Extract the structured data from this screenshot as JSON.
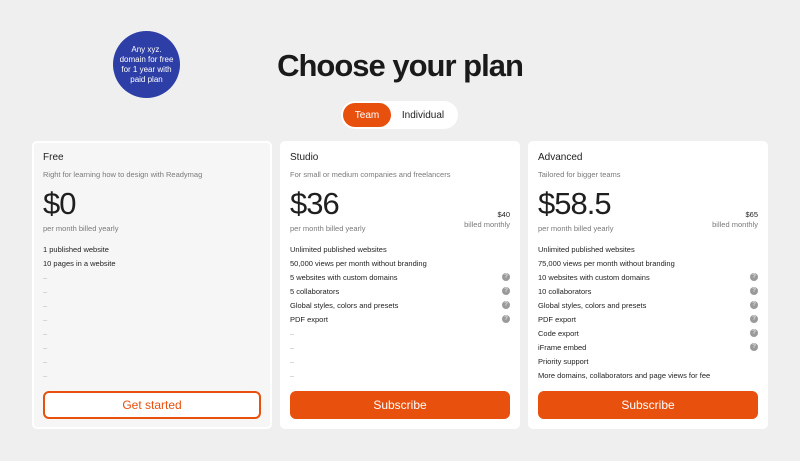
{
  "badge": {
    "text": "Any xyz. domain for free for 1 year with paid plan"
  },
  "page_title": "Choose your plan",
  "toggle": {
    "team": "Team",
    "individual": "Individual"
  },
  "colors": {
    "accent": "#e8500e",
    "badge": "#2d3ea6",
    "background": "#efefef"
  },
  "plans": [
    {
      "name": "Free",
      "description": "Right for learning how to design with Readymag",
      "price": "$0",
      "price_note": "per month billed yearly",
      "features": [
        "1 published website",
        "10 pages in a website",
        "–",
        "–",
        "–",
        "–",
        "–",
        "–",
        "–",
        "–"
      ],
      "help_rows": [],
      "cta": "Get started"
    },
    {
      "name": "Studio",
      "description": "For small or medium companies and freelancers",
      "price": "$36",
      "price_note": "per month billed yearly",
      "alt_price": "$40",
      "alt_note": "billed monthly",
      "features": [
        "Unlimited published websites",
        "50,000 views per month without branding",
        "5 websites with custom domains",
        "5 collaborators",
        "Global styles, colors and presets",
        "PDF export",
        "–",
        "–",
        "–",
        "–"
      ],
      "help_rows": [
        2,
        3,
        4,
        5
      ],
      "cta": "Subscribe"
    },
    {
      "name": "Advanced",
      "description": "Tailored for bigger teams",
      "price": "$58.5",
      "price_note": "per month billed yearly",
      "alt_price": "$65",
      "alt_note": "billed monthly",
      "features": [
        "Unlimited published websites",
        "75,000 views per month without branding",
        "10 websites with custom domains",
        "10 collaborators",
        "Global styles, colors and presets",
        "PDF export",
        "Code export",
        "iFrame embed",
        "Priority support",
        "More domains, collaborators and page views for fee"
      ],
      "help_rows": [
        2,
        3,
        4,
        5,
        6,
        7
      ],
      "cta": "Subscribe"
    }
  ],
  "help_glyph": "?"
}
